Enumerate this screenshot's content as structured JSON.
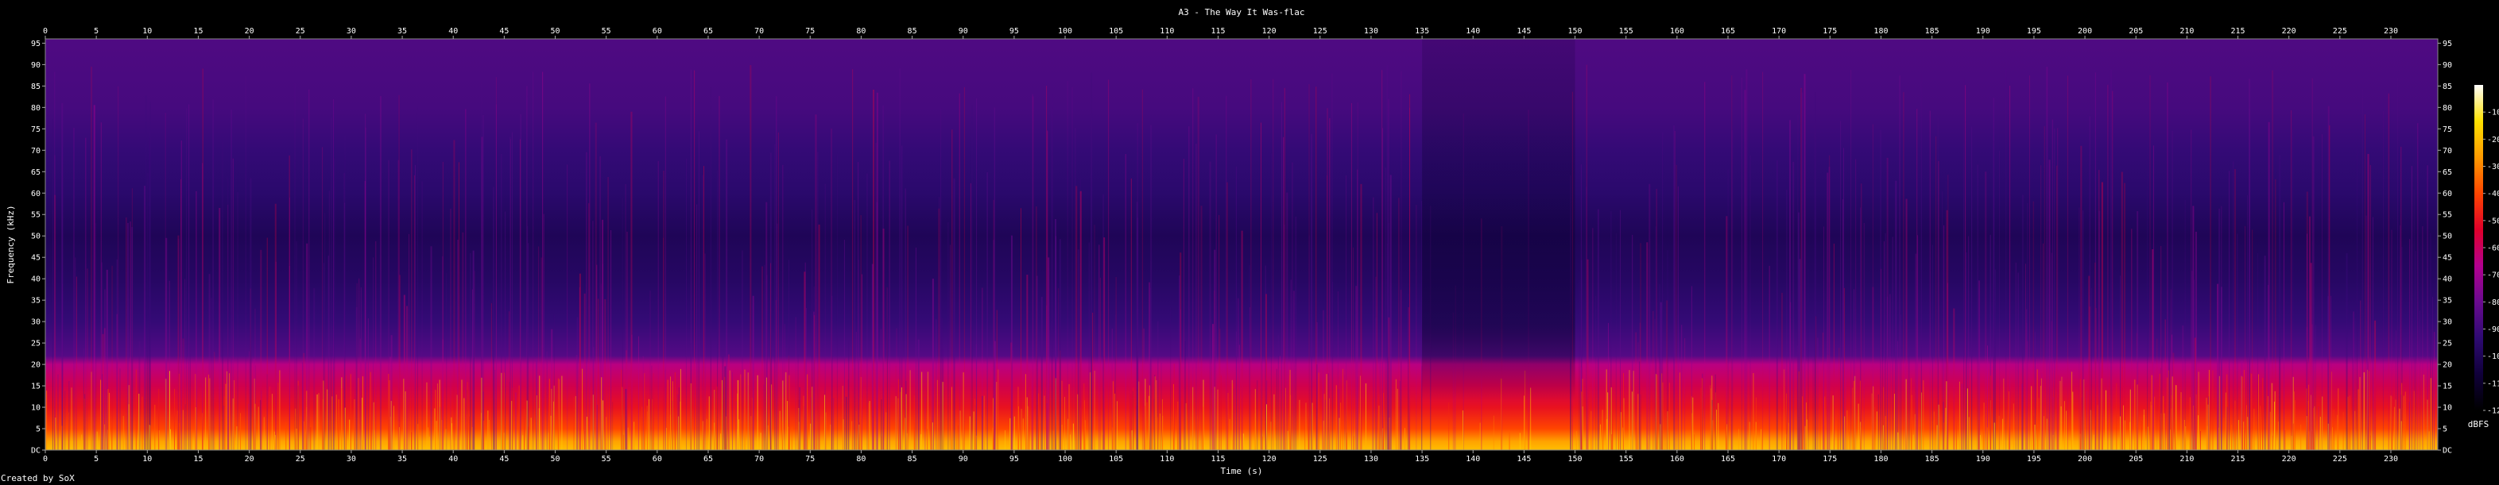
{
  "chart_data": {
    "type": "heatmap",
    "title": "A3 - The Way It Was-flac",
    "xlabel": "Time (s)",
    "ylabel": "Frequency (kHz)",
    "xlim": [
      0,
      234.6
    ],
    "ylim": [
      0,
      96
    ],
    "x_ticks": [
      0,
      5,
      10,
      15,
      20,
      25,
      30,
      35,
      40,
      45,
      50,
      55,
      60,
      65,
      70,
      75,
      80,
      85,
      90,
      95,
      100,
      105,
      110,
      115,
      120,
      125,
      130,
      135,
      140,
      145,
      150,
      155,
      160,
      165,
      170,
      175,
      180,
      185,
      190,
      195,
      200,
      205,
      210,
      215,
      220,
      225,
      230
    ],
    "y_ticks": [
      0,
      5,
      10,
      15,
      20,
      25,
      30,
      35,
      40,
      45,
      50,
      55,
      60,
      65,
      70,
      75,
      80,
      85,
      90,
      95
    ],
    "y_tick_labels": [
      "DC",
      "5",
      "10",
      "15",
      "20",
      "25",
      "30",
      "35",
      "40",
      "45",
      "50",
      "55",
      "60",
      "65",
      "70",
      "75",
      "80",
      "85",
      "90",
      "95"
    ],
    "colorbar": {
      "label": "dBFS",
      "range": [
        -120,
        0
      ],
      "ticks": [
        -10,
        -20,
        -30,
        -40,
        -50,
        -60,
        -70,
        -80,
        -90,
        -100,
        -110,
        -120
      ],
      "stops": [
        "#000000",
        "#10003a",
        "#2e0a73",
        "#6a0a8f",
        "#b3008f",
        "#e0002a",
        "#ff4500",
        "#ff9a00",
        "#ffe100",
        "#ffffff"
      ]
    },
    "spectral_profile": {
      "frequency_khz": [
        0,
        2,
        5,
        10,
        15,
        20,
        22,
        30,
        40,
        50,
        60,
        70,
        80,
        96
      ],
      "level_dbfs": [
        -20,
        -25,
        -40,
        -50,
        -58,
        -65,
        -85,
        -92,
        -97,
        -100,
        -95,
        -92,
        -88,
        -86
      ]
    },
    "quiet_segments_s": [
      [
        135,
        150
      ]
    ],
    "grid": false,
    "legend": "colorbar-right"
  },
  "footer": {
    "credit": "Created by SoX"
  }
}
